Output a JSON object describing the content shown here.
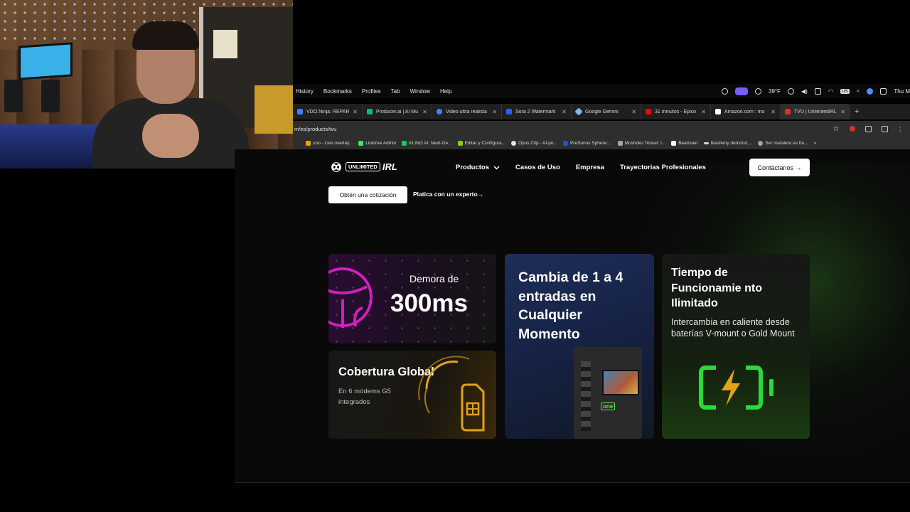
{
  "menubar": {
    "menus": [
      "History",
      "Bookmarks",
      "Profiles",
      "Tab",
      "Window",
      "Help"
    ],
    "weather": "39°F",
    "input_source": "US",
    "clock": "Thu M"
  },
  "tabs": [
    {
      "title": "VDO.Ninja: REPAR",
      "color": "#3b82f6",
      "active": false
    },
    {
      "title": "Producer.ai | AI Mu",
      "color": "#19b37d",
      "active": false
    },
    {
      "title": "Video ultra realista",
      "color": "#4285f4",
      "active": false
    },
    {
      "title": "Sora 2 Watermark",
      "color": "#2563eb",
      "active": false
    },
    {
      "title": "Google Gemini",
      "color": "#8ab4f8",
      "active": false
    },
    {
      "title": "31 minutos - Episo",
      "color": "#ff0000",
      "active": false
    },
    {
      "title": "Amazon.com : mo",
      "color": "#ffffff",
      "active": false
    },
    {
      "title": "TVU | UnlimitedIRL",
      "color": "#d93025",
      "active": true
    }
  ],
  "address": {
    "url": "m/es/products/tvu"
  },
  "bookmarks": [
    {
      "label": "uno - Live overlay...",
      "color": "#f59e0b"
    },
    {
      "label": "Linktree Admin",
      "color": "#43e55e"
    },
    {
      "label": "KLING AI: Next-Ge...",
      "color": "#22c55e"
    },
    {
      "label": "Editar y Configura...",
      "color": "#84cc16"
    },
    {
      "label": "Opus Clip - AI-po...",
      "color": "#e5e5e5"
    },
    {
      "label": "PreSonus Sphere:...",
      "color": "#1d4ed8"
    },
    {
      "label": "Mushoku Tensei: I...",
      "color": "#a3a3a3"
    },
    {
      "label": "Beatoven",
      "color": "#f5f5f5"
    },
    {
      "label": "blasfemy demond,...",
      "color": "#d4d4d4"
    },
    {
      "label": "Ser metalero es bu...",
      "color": "#9ca3af"
    }
  ],
  "site": {
    "logo_box": "UNLIMITED",
    "logo_irl": "IRL",
    "nav": {
      "productos": "Productos",
      "casos": "Casos de Uso",
      "empresa": "Empresa",
      "trayectorias": "Trayectorias Profesionales"
    },
    "contact_button": "Contáctanos →",
    "quote_button": "Obtén una cotización",
    "expert_link": "Platica con un experto→",
    "cards": {
      "latency_label": "Demora de",
      "latency_value": "300ms",
      "global_title": "Cobertura Global",
      "global_sub": "En 6 módems G5 integrados",
      "switch_title": "Cambia de 1 a 4 entradas en Cualquier Momento",
      "switch_badge": "one",
      "uptime_title": "Tiempo de Funcionamie nto Ilimitado",
      "uptime_sub": "Intercambia en caliente desde baterías V-mount o Gold Mount"
    }
  },
  "colors": {
    "accent_green": "#2bd93a",
    "accent_gold": "#e2a21a",
    "accent_magenta": "#d01ec0"
  }
}
